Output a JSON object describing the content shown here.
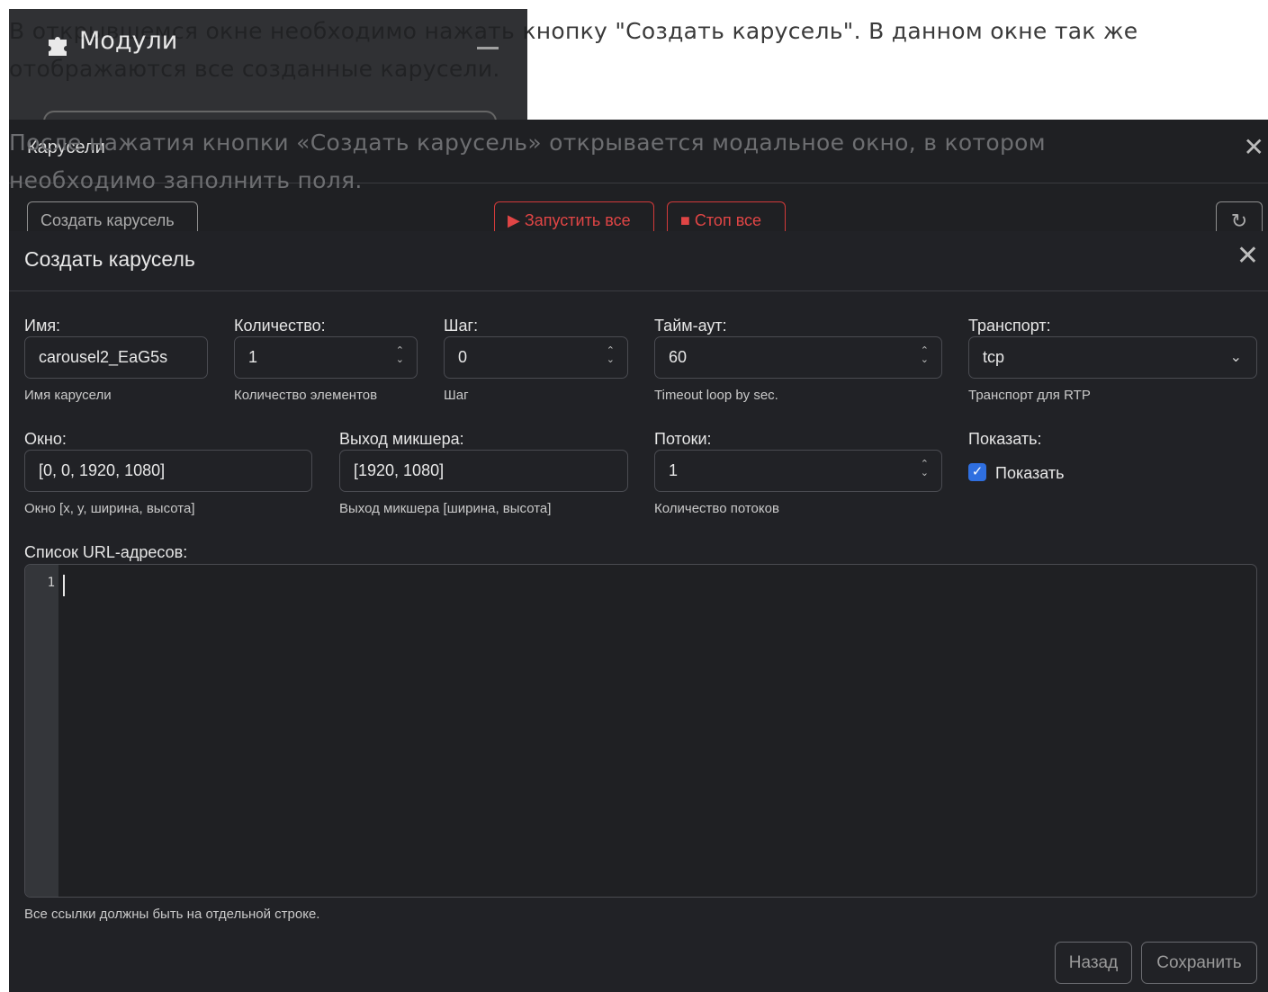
{
  "doc": {
    "paragraph1": "В открывшемся окне необходимо нажать кнопку \"Создать карусель\". В данном окне так же отображаются все созданные карусели.",
    "paragraph2": "После нажатия кнопки «Создать карусель» открывается модальное окно, в котором необходимо заполнить поля."
  },
  "modules_panel": {
    "title": "Модули",
    "icon": "puzzle-icon"
  },
  "carousels_window": {
    "title": "Карусели",
    "create_button": "Создать карусель",
    "start_all_button": "Запустить все",
    "stop_all_button": "Стоп все",
    "refresh_icon": "refresh-icon",
    "accent_color": "#e04545"
  },
  "modal": {
    "title": "Создать карусель",
    "fields": {
      "name": {
        "label": "Имя:",
        "value": "carousel2_EaG5s",
        "hint": "Имя карусели"
      },
      "count": {
        "label": "Количество:",
        "value": "1",
        "hint": "Количество элементов"
      },
      "step": {
        "label": "Шаг:",
        "value": "0",
        "hint": "Шаг"
      },
      "timeout": {
        "label": "Тайм-аут:",
        "value": "60",
        "hint": "Timeout loop by sec."
      },
      "transport": {
        "label": "Транспорт:",
        "value": "tcp",
        "hint": "Транспорт для RTP"
      },
      "window": {
        "label": "Окно:",
        "value": "[0, 0, 1920, 1080]",
        "hint": "Окно [x, y, ширина, высота]"
      },
      "mixer_output": {
        "label": "Выход микшера:",
        "value": "[1920, 1080]",
        "hint": "Выход микшера [ширина, высота]"
      },
      "threads": {
        "label": "Потоки:",
        "value": "1",
        "hint": "Количество потоков"
      },
      "show": {
        "label": "Показать:",
        "checkbox_label": "Показать",
        "checked": true
      },
      "url_list": {
        "label": "Список URL-адресов:",
        "line_number": "1",
        "hint": "Все ссылки должны быть на отдельной строке."
      }
    },
    "back_button": "Назад",
    "save_button": "Сохранить",
    "checkbox_color": "#2f6fe0"
  }
}
